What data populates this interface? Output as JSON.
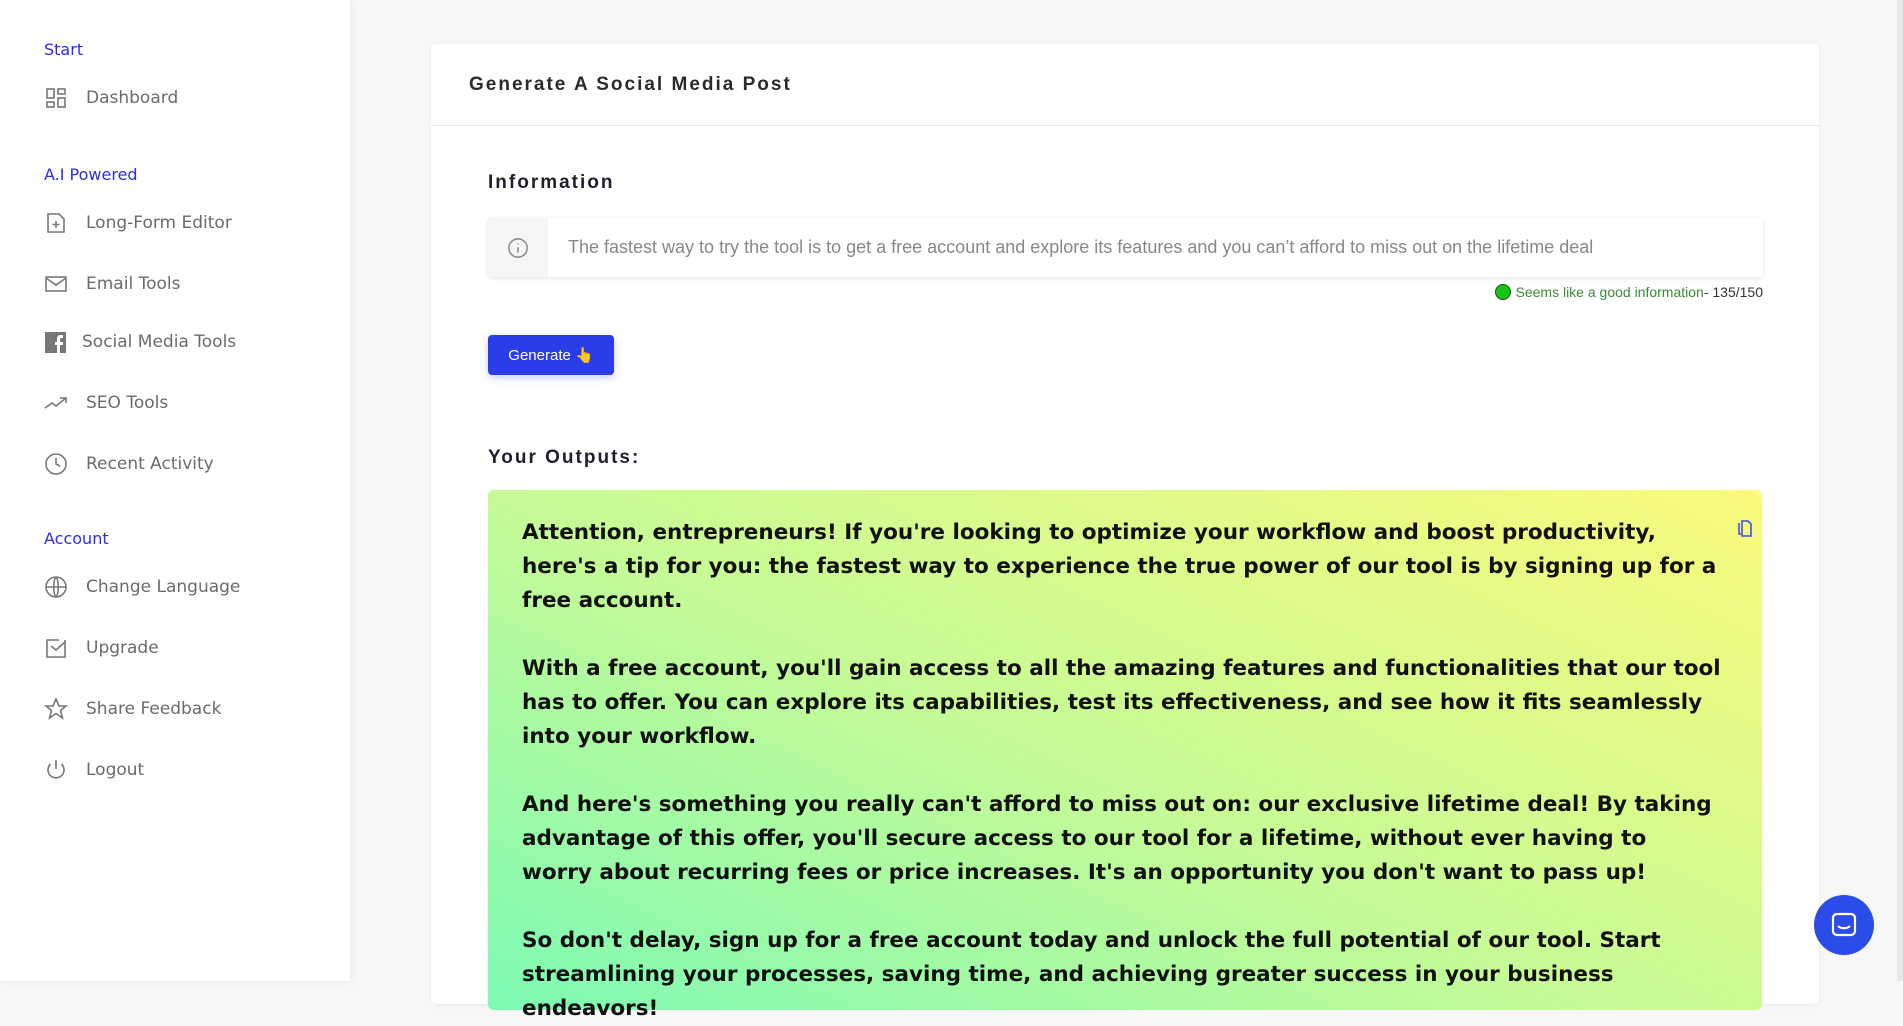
{
  "sidebar": {
    "sections": [
      "Start",
      "A.I Powered",
      "Account"
    ],
    "items": [
      {
        "label": "Dashboard",
        "icon": "dashboard-icon"
      },
      {
        "label": "Long-Form Editor",
        "icon": "file-plus-icon"
      },
      {
        "label": "Email Tools",
        "icon": "mail-icon"
      },
      {
        "label": "Social Media Tools",
        "icon": "facebook-icon"
      },
      {
        "label": "SEO Tools",
        "icon": "trending-up-icon"
      },
      {
        "label": "Recent Activity",
        "icon": "clock-icon"
      },
      {
        "label": "Change Language",
        "icon": "globe-icon"
      },
      {
        "label": "Upgrade",
        "icon": "checkbox-icon"
      },
      {
        "label": "Share Feedback",
        "icon": "star-icon"
      },
      {
        "label": "Logout",
        "icon": "power-icon"
      }
    ]
  },
  "card": {
    "title": "Generate A Social Media Post",
    "info_label": "Information",
    "info_value": "The fastest way to try the tool is to get a free account and explore its features and you can’t afford to miss out on the lifetime deal",
    "hint_text": "Seems like a good information",
    "hint_count": " - 135/150",
    "hint_color": "#3a8a3a",
    "generate_label": "Generate 👆",
    "outputs_label": "Your Outputs:",
    "output_paragraphs": [
      "Attention, entrepreneurs! If you're looking to optimize your workflow and boost productivity, here's a tip for you: the fastest way to experience the true power of our tool is by signing up for a free account.",
      "With a free account, you'll gain access to all the amazing features and functionalities that our tool has to offer. You can explore its capabilities, test its effectiveness, and see how it fits seamlessly into your workflow.",
      "And here's something you really can't afford to miss out on: our exclusive lifetime deal! By taking advantage of this offer, you'll secure access to our tool for a lifetime, without ever having to worry about recurring fees or price increases. It's an opportunity you don't want to pass up!",
      "So don't delay, sign up for a free account today and unlock the full potential of our tool. Start streamlining your processes, saving time, and achieving greater success in your business endeavors!"
    ]
  },
  "accent": "#2b3de8"
}
